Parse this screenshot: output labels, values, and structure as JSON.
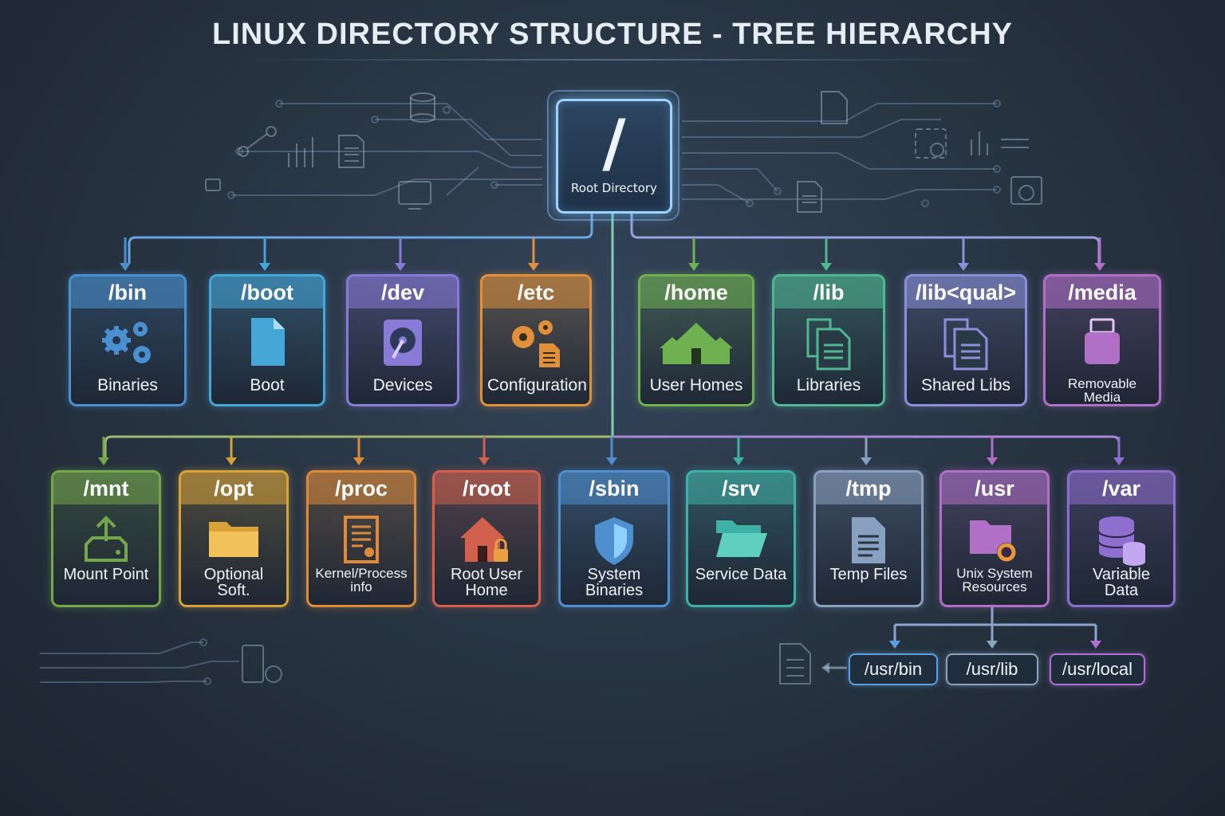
{
  "title": "LINUX DIRECTORY STRUCTURE - TREE HIERARCHY",
  "root": {
    "symbol": "/",
    "label": "Root Directory"
  },
  "row1": [
    {
      "name": "/bin",
      "label": "Binaries",
      "icon": "gears-icon",
      "color": "#4a90d0"
    },
    {
      "name": "/boot",
      "label": "Boot",
      "icon": "file-icon",
      "color": "#45a6d8"
    },
    {
      "name": "/dev",
      "label": "Devices",
      "icon": "hard-disk-icon",
      "color": "#8a7ad8"
    },
    {
      "name": "/etc",
      "label": "Configuration",
      "icon": "config-gears-icon",
      "color": "#e0903a"
    },
    {
      "name": "/home",
      "label": "User Homes",
      "icon": "houses-icon",
      "color": "#6fb050"
    },
    {
      "name": "/lib",
      "label": "Libraries",
      "icon": "documents-icon",
      "color": "#4fb890"
    },
    {
      "name": "/lib<qual>",
      "label": "Shared Libs",
      "icon": "documents-icon",
      "color": "#8d8fd8"
    },
    {
      "name": "/media",
      "label": "Removable Media",
      "icon": "usb-drive-icon",
      "color": "#b070c8"
    }
  ],
  "row2": [
    {
      "name": "/mnt",
      "label": "Mount Point",
      "icon": "mount-upload-icon",
      "color": "#74a64c"
    },
    {
      "name": "/opt",
      "label": "Optional Soft.",
      "icon": "folder-icon",
      "color": "#d8a238"
    },
    {
      "name": "/proc",
      "label": "Kernel/Process info",
      "icon": "document-badge-icon",
      "color": "#dd8a3a"
    },
    {
      "name": "/root",
      "label": "Root User Home",
      "icon": "house-lock-icon",
      "color": "#d2604c"
    },
    {
      "name": "/sbin",
      "label": "System Binaries",
      "icon": "shield-icon",
      "color": "#4e8fd0"
    },
    {
      "name": "/srv",
      "label": "Service Data",
      "icon": "open-folder-icon",
      "color": "#3fb0a8"
    },
    {
      "name": "/tmp",
      "label": "Temp Files",
      "icon": "file-text-icon",
      "color": "#8aa0c0"
    },
    {
      "name": "/usr",
      "label": "Unix System Resources",
      "icon": "folder-gear-icon",
      "color": "#b070c8"
    },
    {
      "name": "/var",
      "label": "Variable Data",
      "icon": "database-icon",
      "color": "#8e6fd0"
    }
  ],
  "usr_children": [
    {
      "name": "/usr/bin",
      "color": "#5aa0e0"
    },
    {
      "name": "/usr/lib",
      "color": "#8aa4c0"
    },
    {
      "name": "/usr/local",
      "color": "#b070d0"
    }
  ]
}
